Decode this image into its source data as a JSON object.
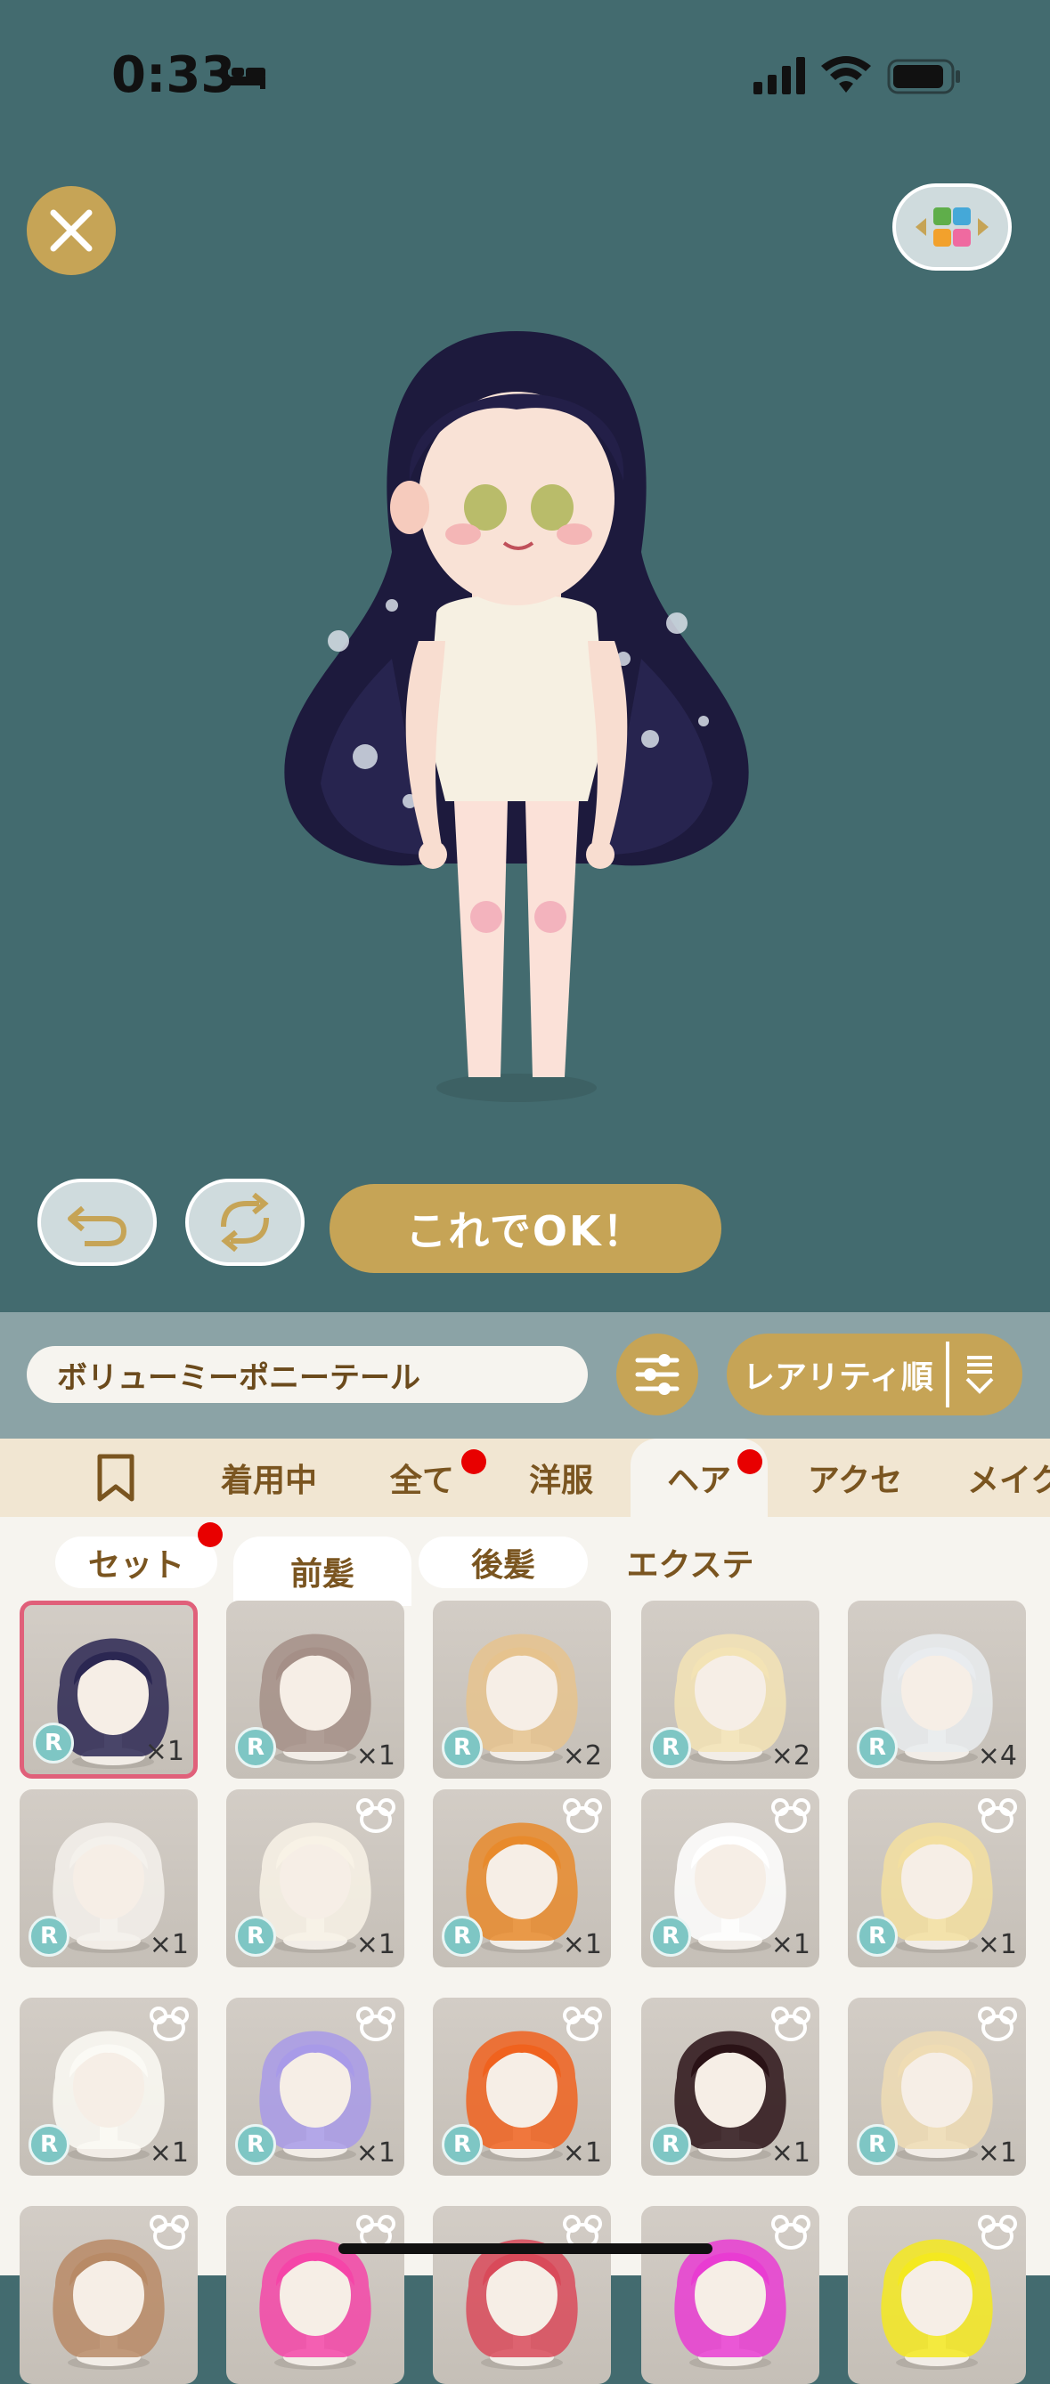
{
  "status": {
    "time": "0:33",
    "icons": [
      "bed-icon",
      "signal-icon",
      "wifi-icon",
      "battery-icon"
    ]
  },
  "top": {
    "close_icon": "close-icon",
    "layout_icon": "grid-arrows-icon"
  },
  "preview": {
    "ok_label": "これでOK！",
    "undo_icon": "undo-icon",
    "reset_icon": "refresh-icon"
  },
  "item_bar": {
    "item_name": "ボリューミーポニーテール",
    "filter_icon": "sliders-icon",
    "sort_label": "レアリティ順",
    "sort_icon": "sort-icon"
  },
  "tabs": [
    {
      "label": "",
      "icon": "bookmark-icon"
    },
    {
      "label": "着用中"
    },
    {
      "label": "全て",
      "dot": true
    },
    {
      "label": "洋服"
    },
    {
      "label": "ヘア",
      "dot": true,
      "active": true
    },
    {
      "label": "アクセ"
    },
    {
      "label": "メイク"
    }
  ],
  "subtabs": [
    {
      "label": "セット",
      "dot": true,
      "active": true
    },
    {
      "label": "前髪"
    },
    {
      "label": "後髪",
      "active": true
    },
    {
      "label": "エクステ"
    }
  ],
  "items": [
    {
      "hair_color": "#2b2752",
      "rarity": "R",
      "count": "×1",
      "bear": false,
      "selected": true
    },
    {
      "hair_color": "#a58f87",
      "rarity": "R",
      "count": "×1",
      "bear": false
    },
    {
      "hair_color": "#e6c38e",
      "rarity": "R",
      "count": "×2",
      "bear": false
    },
    {
      "hair_color": "#f3e3b5",
      "rarity": "R",
      "count": "×2",
      "bear": false
    },
    {
      "hair_color": "#e9ecef",
      "rarity": "R",
      "count": "×4",
      "bear": false
    },
    {
      "hair_color": "#f4f1ec",
      "rarity": "R",
      "count": "×1",
      "bear": false
    },
    {
      "hair_color": "#f8f2e6",
      "rarity": "R",
      "count": "×1",
      "bear": true
    },
    {
      "hair_color": "#e88a2c",
      "rarity": "R",
      "count": "×1",
      "bear": true
    },
    {
      "hair_color": "#ffffff",
      "rarity": "R",
      "count": "×1",
      "bear": true
    },
    {
      "hair_color": "#f3dfa0",
      "rarity": "R",
      "count": "×1",
      "bear": true
    },
    {
      "hair_color": "#fbfaf5",
      "rarity": "R",
      "count": "×1",
      "bear": true
    },
    {
      "hair_color": "#a89ae8",
      "rarity": "R",
      "count": "×1",
      "bear": true
    },
    {
      "hair_color": "#f0621e",
      "rarity": "R",
      "count": "×1",
      "bear": true
    },
    {
      "hair_color": "#2a1216",
      "rarity": "R",
      "count": "×1",
      "bear": true
    },
    {
      "hair_color": "#efdcb4",
      "rarity": "R",
      "count": "×1",
      "bear": true
    },
    {
      "hair_color": "#b88a66",
      "rarity": "",
      "count": "",
      "bear": true
    },
    {
      "hair_color": "#f545a8",
      "rarity": "",
      "count": "",
      "bear": true
    },
    {
      "hair_color": "#d94a5a",
      "rarity": "",
      "count": "",
      "bear": true
    },
    {
      "hair_color": "#e93cd2",
      "rarity": "",
      "count": "",
      "bear": true
    },
    {
      "hair_color": "#f4e920",
      "rarity": "",
      "count": "",
      "bear": true
    }
  ],
  "colors": {
    "background": "#436b6f",
    "gold": "#c6a456",
    "panel": "#f6f4ef",
    "tab_bar": "#f1e6d2"
  }
}
